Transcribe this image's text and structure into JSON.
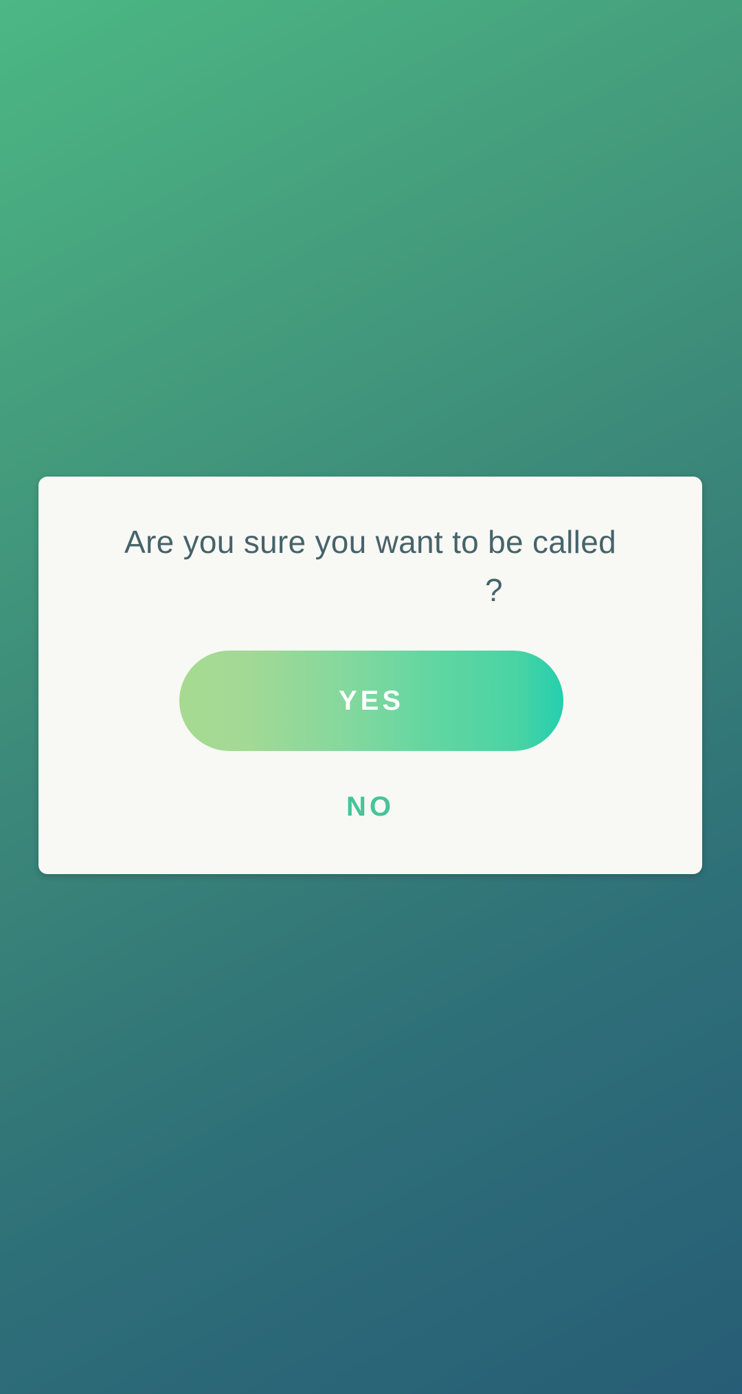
{
  "dialog": {
    "message_line1": "Are you sure you want to be called",
    "name": "",
    "question_mark": "?",
    "yes_label": "YES",
    "no_label": "NO"
  },
  "colors": {
    "background_top": "#4cb884",
    "background_bottom": "#275d76",
    "dialog_bg": "#f8f8f5",
    "text": "#46636a",
    "yes_gradient_start": "#a6da91",
    "yes_gradient_end": "#24cfae",
    "no_text": "#45c49a"
  }
}
